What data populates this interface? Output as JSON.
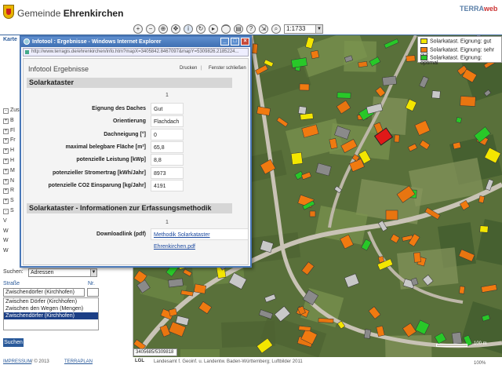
{
  "header": {
    "title_prefix": "Gemeinde ",
    "title_bold": "Ehrenkirchen",
    "logo_a": "TERRA",
    "logo_b": "web"
  },
  "toolbar": {
    "icons": [
      "zoom-in",
      "zoom-out",
      "full-extent",
      "pan",
      "refresh",
      "info",
      "print",
      "measure",
      "help",
      "search"
    ],
    "scale": "1:1733"
  },
  "left_panel": {
    "tab": "Karte",
    "tree": [
      {
        "sym": "-",
        "label": "Zusc"
      },
      {
        "sym": "+",
        "label": "B"
      },
      {
        "sym": "+",
        "label": "Fl"
      },
      {
        "sym": "+",
        "label": "Fr"
      },
      {
        "sym": "+",
        "label": "H"
      },
      {
        "sym": "+",
        "label": "H"
      },
      {
        "sym": "+",
        "label": "M"
      },
      {
        "sym": "+",
        "label": "N"
      },
      {
        "sym": "+",
        "label": "R"
      },
      {
        "sym": "+",
        "label": "S"
      },
      {
        "sym": "-",
        "label": "S"
      },
      {
        "sym": "",
        "label": "V"
      },
      {
        "sym": "",
        "label": "W"
      },
      {
        "sym": "",
        "label": "W"
      },
      {
        "sym": "",
        "label": "W"
      }
    ],
    "search_label": "Suchen:",
    "search_type": "Adressen",
    "street_label": "Straße",
    "nr_label": "Nr.",
    "street_value": "Zwischendörfer (Kirchhofen)",
    "street_options": [
      "Zwischen Dörfer (Kirchhofen)",
      "Zwischen den Wegen (Mengen)",
      "Zwischendörfer (Kirchhofen)"
    ],
    "selected_index": 2,
    "search_button": "Suchen"
  },
  "legend": [
    {
      "label": "Solarkatast. Eignung: gut",
      "color": "#f3e600"
    },
    {
      "label": "Solarkatast. Eignung: sehr gut",
      "color": "#f07a10"
    },
    {
      "label": "Solarkatast. Eignung: optimal",
      "color": "#28c828"
    }
  ],
  "map": {
    "coords": "3405685/5309818",
    "scale_label": "100 m"
  },
  "footer": {
    "impressum": "IMPRESSUM",
    "copyright": "/ © 2013",
    "terraplan": "TERRAPLAN",
    "lgl_logo": "LGL",
    "lgl_text": "Landesamt f. Geoinf. u. Landentw. Baden-Württemberg; Luftbilder 2011",
    "zoom": "100%"
  },
  "popup": {
    "window_title": "Infotool : Ergebnisse - Windows Internet Explorer",
    "url": "http://www.terragis.de/ehrenkirchen/info.htm?mapX=3405842.8467097&mapY=5309826.2185224...",
    "heading": "Infotool Ergebnisse",
    "print": "Drucken",
    "separator": "|",
    "close": "Fenster schließen",
    "section1": {
      "title": "Solarkataster",
      "index": "1",
      "rows": [
        {
          "k": "Eignung des Daches",
          "v": "Gut"
        },
        {
          "k": "Orientierung",
          "v": "Flachdach"
        },
        {
          "k": "Dachneigung [°]",
          "v": "0"
        },
        {
          "k": "maximal belegbare Fläche [m²]",
          "v": "65,8"
        },
        {
          "k": "potenzielle Leistung [kWp]",
          "v": "8,8"
        },
        {
          "k": "potenzieller Stromertrag [kWh/Jahr]",
          "v": "8973"
        },
        {
          "k": "potenzielle CO2 Einsparung [kg/Jahr]",
          "v": "4191"
        }
      ]
    },
    "section2": {
      "title": "Solarkataster - Informationen zur Erfassungsmethodik",
      "index": "1",
      "download_label": "Downloadlink (pdf)",
      "download_link": "Methodik Solarkataster Ehrenkirchen.pdf"
    }
  }
}
